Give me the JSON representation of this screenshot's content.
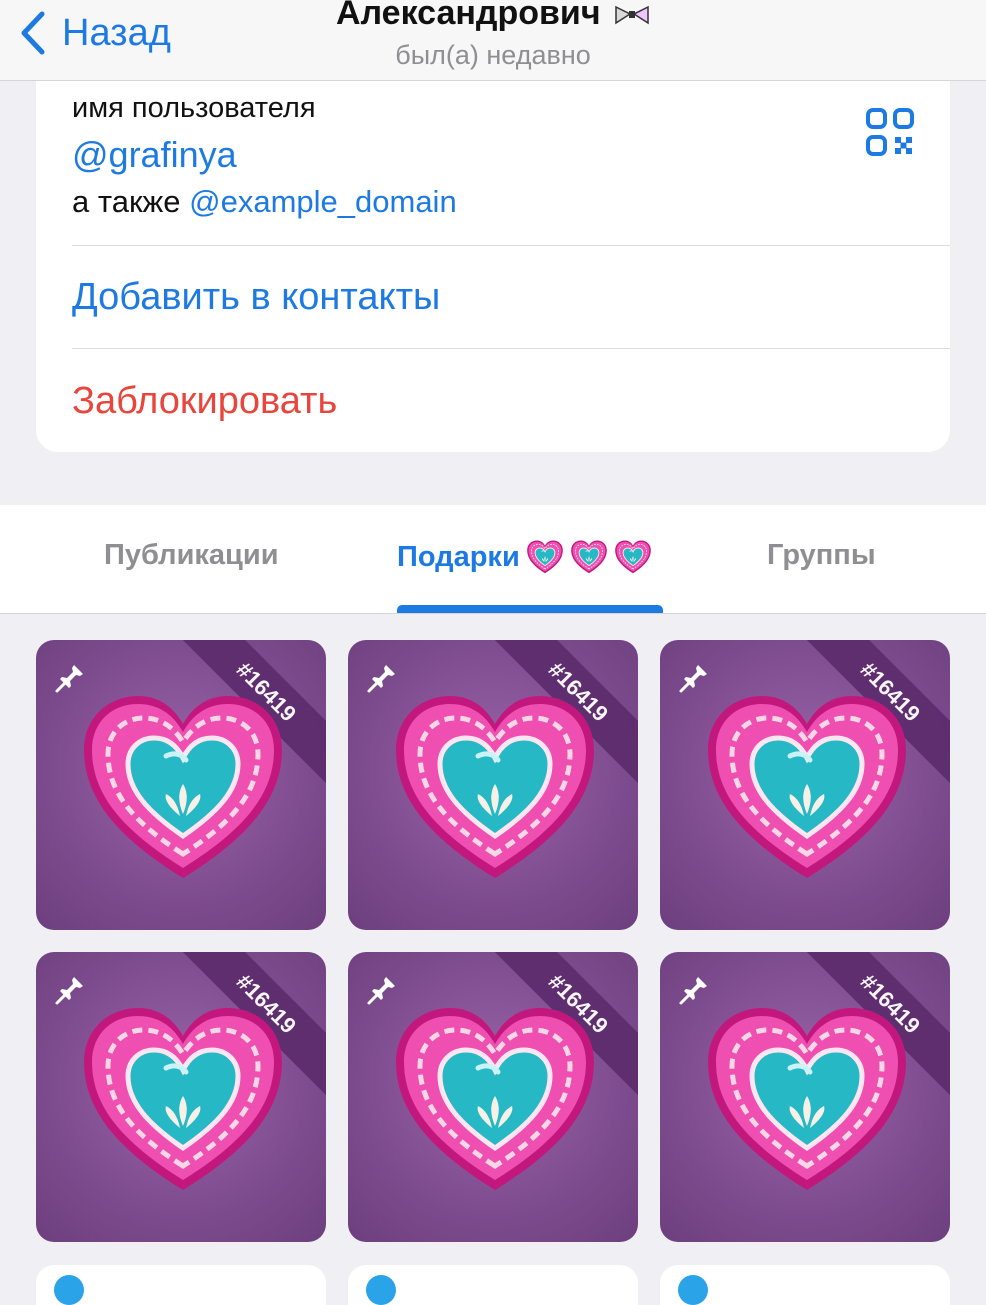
{
  "header": {
    "back_label": "Назад",
    "title": "Александрович",
    "subtitle": "был(а) недавно"
  },
  "info": {
    "username_label": "имя пользователя",
    "username": "@grafinya",
    "also_prefix": "а также",
    "also_username": "@example_domain",
    "add_contact": "Добавить в контакты",
    "block": "Заблокировать"
  },
  "tabs": [
    {
      "label": "Публикации",
      "active": false
    },
    {
      "label": "Подарки",
      "active": true
    },
    {
      "label": "Группы",
      "active": false
    }
  ],
  "gifts": [
    {
      "number": "#16419"
    },
    {
      "number": "#16419"
    },
    {
      "number": "#16419"
    },
    {
      "number": "#16419"
    },
    {
      "number": "#16419"
    },
    {
      "number": "#16419"
    }
  ],
  "colors": {
    "accent": "#1d7ae3",
    "danger": "#e8453c",
    "gift_bg": "#7b4a8c"
  },
  "icons": [
    "chevron-left-icon",
    "qr-code-icon",
    "pin-icon",
    "heart-gift-icon"
  ]
}
